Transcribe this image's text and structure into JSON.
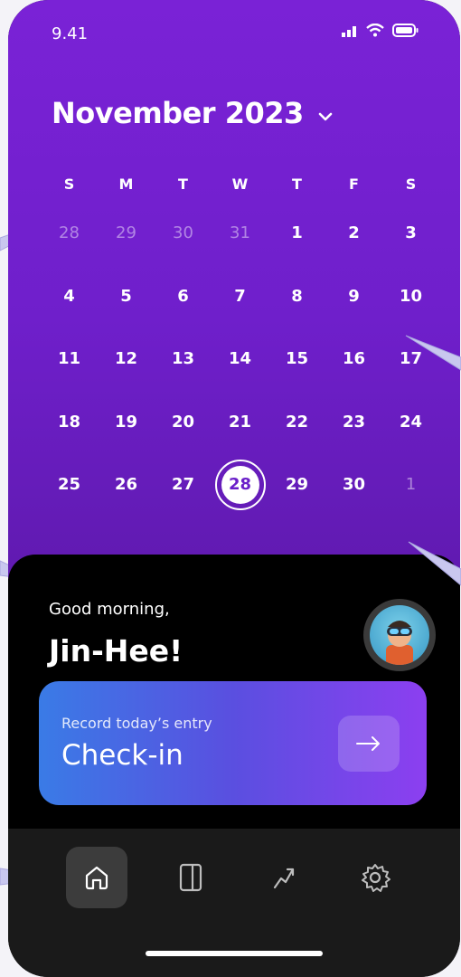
{
  "status": {
    "time": "9.41"
  },
  "calendar": {
    "month_title": "November 2023",
    "weekdays": [
      "S",
      "M",
      "T",
      "W",
      "T",
      "F",
      "S"
    ],
    "weeks": [
      [
        "28",
        "29",
        "30",
        "31",
        "1",
        "2",
        "3"
      ],
      [
        "4",
        "5",
        "6",
        "7",
        "8",
        "9",
        "10"
      ],
      [
        "11",
        "12",
        "13",
        "14",
        "15",
        "16",
        "17"
      ],
      [
        "18",
        "19",
        "20",
        "21",
        "22",
        "23",
        "24"
      ],
      [
        "25",
        "26",
        "27",
        "28",
        "29",
        "30",
        "1"
      ]
    ],
    "selected_day": "28"
  },
  "greeting": {
    "line1": "Good morning,",
    "name": "Jin-Hee!"
  },
  "checkin": {
    "subtitle": "Record today’s entry",
    "title": "Check-in"
  },
  "nav": {
    "items": [
      "home-icon",
      "journal-icon",
      "trend-icon",
      "settings-icon"
    ],
    "active": "home-icon"
  },
  "colors": {
    "accent": "#7a22d6",
    "gradient_start": "#3a7be6",
    "gradient_end": "#8c3ff0"
  }
}
